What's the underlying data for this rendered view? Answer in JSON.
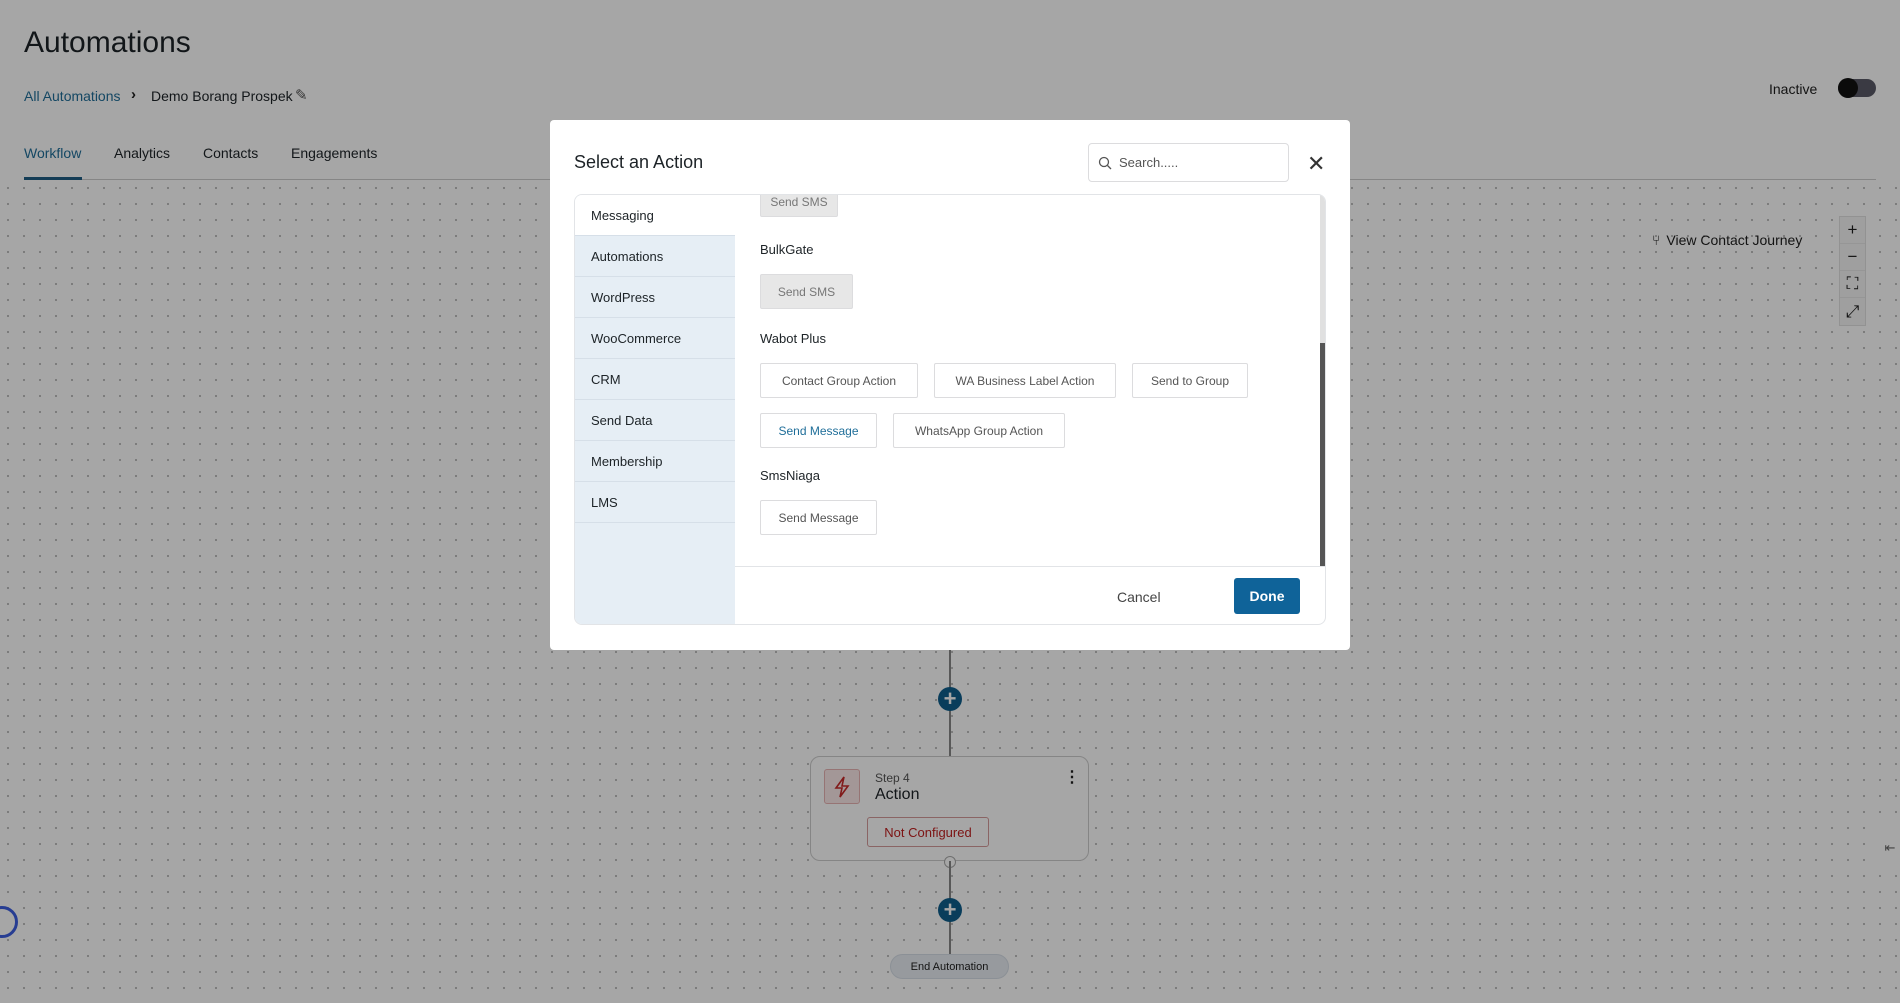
{
  "page": {
    "title": "Automations"
  },
  "breadcrumb": {
    "root": "All Automations",
    "current": "Demo Borang Prospek"
  },
  "tabs": [
    {
      "label": "Workflow",
      "active": true
    },
    {
      "label": "Analytics"
    },
    {
      "label": "Contacts"
    },
    {
      "label": "Engagements"
    }
  ],
  "status": {
    "label": "Inactive",
    "active": false
  },
  "canvas": {
    "view_journey": "View Contact Journey",
    "zoom_controls": [
      "+",
      "−",
      "fit",
      "expand"
    ],
    "step": {
      "label": "Step 4",
      "title": "Action",
      "status": "Not Configured",
      "icon": "lightning-icon"
    },
    "end": "End Automation"
  },
  "modal": {
    "title": "Select an Action",
    "search_placeholder": "Search.....",
    "categories": [
      "Messaging",
      "Automations",
      "WordPress",
      "WooCommerce",
      "CRM",
      "Send Data",
      "Membership",
      "LMS"
    ],
    "active_category": "Messaging",
    "groups": {
      "top_cut": {
        "actions": [
          "Send SMS"
        ]
      },
      "bulkgate": {
        "name": "BulkGate",
        "actions": [
          "Send SMS"
        ]
      },
      "wabot": {
        "name": "Wabot Plus",
        "actions": [
          "Contact Group Action",
          "WA Business Label Action",
          "Send to Group",
          "Send Message",
          "WhatsApp Group Action"
        ],
        "selected": "Send Message"
      },
      "smsniaga": {
        "name": "SmsNiaga",
        "actions": [
          "Send Message"
        ]
      }
    },
    "cancel": "Cancel",
    "done": "Done"
  },
  "colors": {
    "accent": "#0f6399",
    "link": "#1f6e99",
    "error": "#c01f1f"
  }
}
